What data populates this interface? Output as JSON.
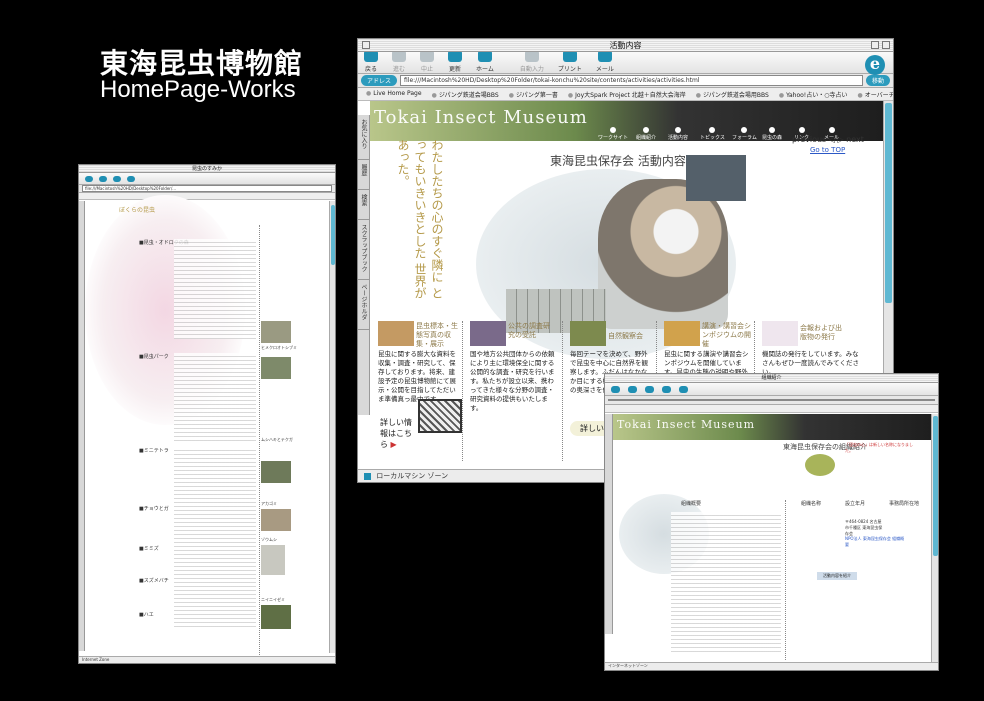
{
  "brand": {
    "title": "東海昆虫博物館",
    "subtitle": "HomePage-Works"
  },
  "windows": {
    "left": {
      "title": "昆虫のすみか",
      "address": "file:///Macintosh%20HD/Desktop%20Folder/...",
      "site_title": "ぼくらの昆虫",
      "sections": [
        "■昆虫・オドロクの森",
        "■昆虫パーク",
        "■ミニテトラ",
        "■チョウとガ",
        "■ミミズ",
        "■スズメバチ",
        "■ハエ"
      ],
      "captions": [
        "ヒメクロオトシブミ",
        "ムシハキとテクガ",
        "アカゴミ",
        "ゾウムシ",
        "ニイニイゼミ"
      ],
      "status": "Internet Zone"
    },
    "main": {
      "title": "活動内容",
      "toolbar": [
        "戻る",
        "進む",
        "中止",
        "更新",
        "ホーム",
        "自動入力",
        "プリント",
        "メール"
      ],
      "address_label": "アドレス",
      "address": "file:///Macintosh%20HD/Desktop%20Folder/tokai-konchu%20site/contents/activities/activities.html",
      "go_label": "移動",
      "favorites": [
        "Live Home Page",
        "ジパング鉄道会場BBS",
        "ジパング第一書",
        "Joy大Spark Project 北越＋自然大会海岸",
        "ジパング鉄道会場用BBS",
        "Yahoo!占い・○寺占い",
        "オーバーチュア"
      ],
      "side_tabs": [
        "お気に入り",
        "履歴",
        "検索",
        "スクラップブック",
        "ページホルダ"
      ],
      "site_logo": "Tokai Insect Museum",
      "nav": [
        "ワークサイト",
        "組織紹介",
        "活動内容",
        "トピックス",
        "フォーラム",
        "昆虫の森",
        "リンク",
        "メール"
      ],
      "prev_next": "previous ◁ ▷ next",
      "go_to_top": "Go to TOP",
      "page_title": "東海昆虫保存会 活動内容",
      "poem": "わたしたちの心のすぐ隣に とってもいきいきとした 世界があった。",
      "categories": [
        {
          "title": "昆虫標本・生態写真の収集・展示",
          "desc": "昆虫に関する膨大な資料を収集・調査・研究して、保存しております。将来、建設予定の昆虫博物館にて展示・公開を目指してただいま準備真っ最中です。"
        },
        {
          "title": "公共の調査研究の受託",
          "desc": "国や地方公共団体からの依頼により主に環境保全に関する公開的な調査・研究を行います。私たちが設立以来、携わってきた様々な分野の調査・研究資料の提供もいたします。"
        },
        {
          "title": "自然観察会",
          "desc": "毎回テーマを決めて、野外で昆虫を中心に自然界を観察します。ふだんはなかなか目にする機会のない自然の奥深さを体感できます。"
        },
        {
          "title": "講演・講習会シンポジウムの開催",
          "desc": "昆虫に関する講演や講習会シンポジウムを開催しています。昆虫の生態の説明や野外での昆虫の観察など"
        },
        {
          "title": "会報および出版物の発行",
          "desc": "機関誌の発行をしています。みなさんもぜひ一度読んでみてください。"
        }
      ],
      "more_link": "詳しい情報はこちら",
      "more_button": "詳しい情報",
      "status": "ローカルマシン ゾーン"
    },
    "right": {
      "title": "組織紹介",
      "page_title": "東海昆虫保存会の組織紹介",
      "notice": "「昆虫の心」は新しい名称になりました。",
      "columns": [
        "組織概要",
        "組織名称",
        "設立年月",
        "事務局所在地"
      ],
      "address_block": "〒464-0824 名古屋市千種区 東海昆虫保存会",
      "contact_link": "NPO法人 東海昆虫保存会 組織概要",
      "section_button": "活動内容を紹介",
      "status": "インターネットゾーン"
    }
  }
}
